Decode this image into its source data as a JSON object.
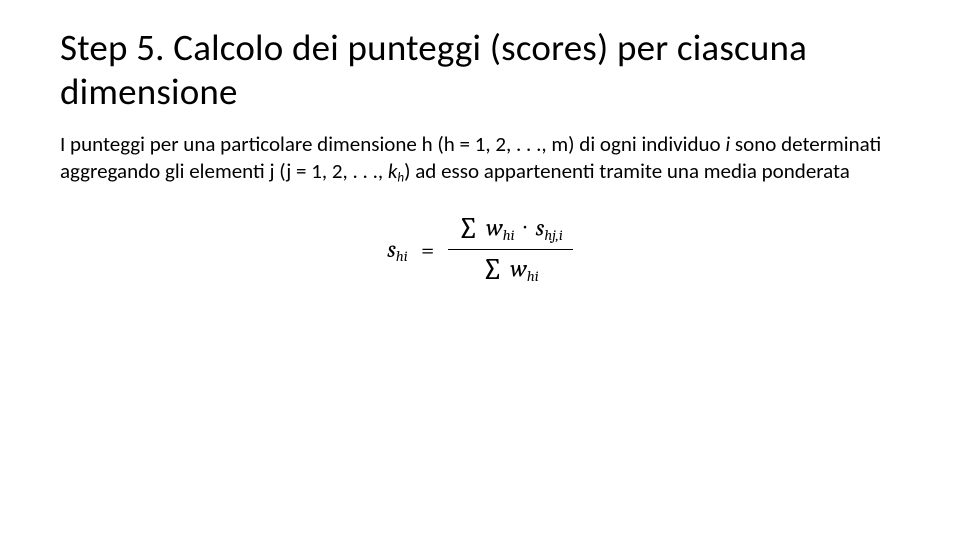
{
  "title": "Step 5. Calcolo dei punteggi (scores) per ciascuna dimensione",
  "body": {
    "p1_a": "I punteggi per una particolare dimensione h (h = 1, 2, . . ., m) di ogni individuo ",
    "p1_i": "i",
    "p1_b": " sono determinati aggregando gli elementi j (j = 1, 2, . . ., ",
    "p1_k": "k",
    "p1_ksub": "h",
    "p1_c": ") ad esso appartenenti tramite una media ponderata"
  },
  "formula": {
    "lhs_var": "s",
    "lhs_sub": "hi",
    "eq": "=",
    "sum_glyph": "∑",
    "num_w": "w",
    "num_w_sub": "hi",
    "dot": "·",
    "num_s": "s",
    "num_s_sub": "hj,i",
    "den_w": "w",
    "den_w_sub": "hi"
  }
}
